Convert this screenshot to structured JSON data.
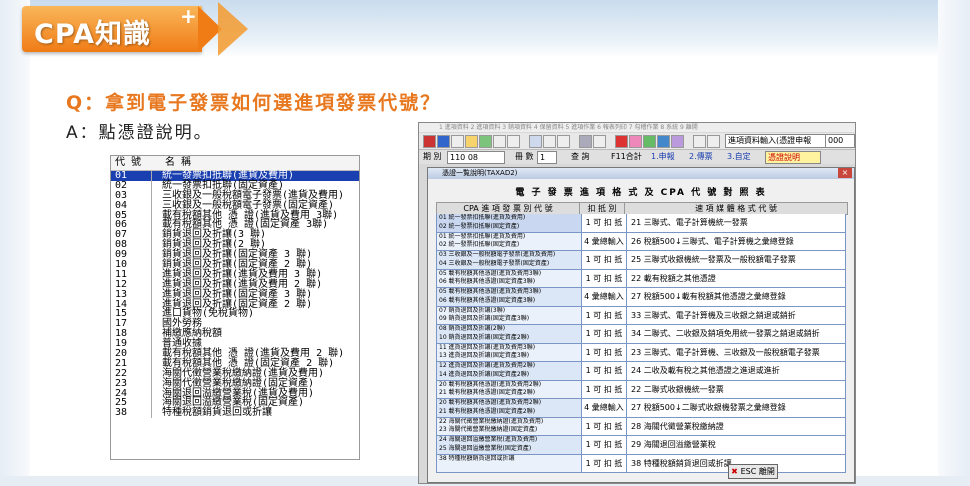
{
  "logo": {
    "text": "CPA知識",
    "plus": "+"
  },
  "question": "Q：拿到電子發票如何選進項發票代號？",
  "answer": "A：點憑證說明。",
  "code_table": {
    "header": {
      "code": "代 號",
      "name": "名 稱"
    },
    "rows": [
      {
        "code": "01",
        "name": "統一發票扣抵聯(進貨及費用)",
        "selected": true
      },
      {
        "code": "02",
        "name": "統一發票扣抵聯(固定資產)"
      },
      {
        "code": "03",
        "name": "三收銀及一般稅額電子發票(進貨及費用)"
      },
      {
        "code": "04",
        "name": "三收銀及一般稅額電子發票(固定資產)"
      },
      {
        "code": "05",
        "name": "載有稅額其他 憑 證(進貨及費用 3聯)"
      },
      {
        "code": "06",
        "name": "載有稅額其他 憑 證(固定資產 3聯)"
      },
      {
        "code": "07",
        "name": "銷貨退回及折讓(3 聯)"
      },
      {
        "code": "08",
        "name": "銷貨退回及折讓(2 聯)"
      },
      {
        "code": "09",
        "name": "銷貨退回及折讓(固定資產 3 聯)"
      },
      {
        "code": "10",
        "name": "銷貨退回及折讓(固定資產 2 聯)"
      },
      {
        "code": "11",
        "name": "進貨退回及折讓(進貨及費用 3 聯)"
      },
      {
        "code": "12",
        "name": "進貨退回及折讓(進貨及費用 2 聯)"
      },
      {
        "code": "13",
        "name": "進貨退回及折讓(固定資產 3 聯)"
      },
      {
        "code": "14",
        "name": "進貨退回及折讓(固定資產 2 聯)"
      },
      {
        "code": "15",
        "name": "進口貨物(免稅貨物)"
      },
      {
        "code": "17",
        "name": "國外勞務"
      },
      {
        "code": "18",
        "name": "補繳應納稅額"
      },
      {
        "code": "19",
        "name": "普通收據"
      },
      {
        "code": "20",
        "name": "載有稅額其他 憑 證(進貨及費用 2 聯)"
      },
      {
        "code": "21",
        "name": "載有稅額其他 憑 證(固定資產 2 聯)"
      },
      {
        "code": "22",
        "name": "海關代徵營業稅繳納證(進貨及費用)"
      },
      {
        "code": "23",
        "name": "海關代徵營業稅繳納證(固定資產)"
      },
      {
        "code": "24",
        "name": "海關退回溢繳營業稅(進貨及費用)"
      },
      {
        "code": "25",
        "name": "海關退回溢繳營業稅(固定資產)"
      },
      {
        "code": "38",
        "name": "特種稅額銷貨退回或折讓"
      }
    ]
  },
  "window": {
    "menubar": "1 進項資料   2 進項資料   3 銷項資料   4 保留資料   5 進項作業   6 報表列印   7 勾稽作業   8 系統   9 離開",
    "select_value": "進項資料輸入(憑證申報",
    "number_field": "000",
    "filter": {
      "period_label": "期 別",
      "period_value": "110 08",
      "count_label": "冊 數",
      "count_value": "1",
      "query_label": "查 詢",
      "f11_label": "F11合計",
      "radio1": "1.申報",
      "radio2": "2.傳票",
      "radio3": "3.自定",
      "help_label": "憑證說明"
    },
    "dialog": {
      "title": "憑證一覧說明(TAXAD2)",
      "close": "×",
      "heading": "電 子 發 票 進 項 格 式 及 CPA 代 號 對 照 表",
      "columns": [
        "CPA 進 項 發 票 別 代 號",
        "扣 抵 別",
        "速 項 媒 體 格 式 代 號"
      ],
      "rows": [
        {
          "codes": [
            "01 統一發票扣抵聯(進貨及費用)",
            "02 統一發票扣抵聯(固定資產)"
          ],
          "deduct": "1 可 扣 抵",
          "media": "21 三聯式、電子計算機統一發票"
        },
        {
          "codes": [
            "01 統一發票扣抵聯(進貨及費用)",
            "02 統一發票扣抵聯(固定資產)"
          ],
          "deduct": "4 彙總輸入",
          "media": "26 稅額500↓三聯式、電子計算機之彙總登錄"
        },
        {
          "codes": [
            "03 三收銀及一般稅額電子發票(進貨及費用)",
            "04 三收銀及一般稅額電子發票(固定資產)"
          ],
          "deduct": "1 可 扣 抵",
          "media": "25 三聯式收銀機統一發票及一般稅額電子發票"
        },
        {
          "codes": [
            "05 載有稅額其他憑證(進貨及費用3聯)",
            "06 載有稅額其他憑證(固定資產3聯)"
          ],
          "deduct": "1 可 扣 抵",
          "media": "22 載有稅額之其他憑證"
        },
        {
          "codes": [
            "05 載有稅額其他憑證(進貨及費用3聯)",
            "06 載有稅額其他憑證(固定資產3聯)"
          ],
          "deduct": "4 彙總輸入",
          "media": "27 稅額500↓載有稅額其他憑證之彙總登錄"
        },
        {
          "codes": [
            "07 銷貨退回及折讓(3聯)",
            "09 銷貨退回及折讓(固定資產3聯)"
          ],
          "deduct": "1 可 扣 抵",
          "media": "33 三聯式、電子計算機及三收銀之銷退或銷折"
        },
        {
          "codes": [
            "08 銷貨退回及折讓(2聯)",
            "10 銷貨退回及折讓(固定資產2聯)"
          ],
          "deduct": "1 可 扣 抵",
          "media": "34 二聯式、二收銀及銷項免用統一發票之銷退或銷折"
        },
        {
          "codes": [
            "11 進貨退回及折讓(進貨及費用3聯)",
            "13 進貨退回及折讓(固定資產3聯)"
          ],
          "deduct": "1 可 扣 抵",
          "media": "23 三聯式、電子計算機、三收銀及一般稅額電子發票"
        },
        {
          "codes": [
            "12 進貨退回及折讓(進貨及費用2聯)",
            "14 進貨退回及折讓(固定資產2聯)"
          ],
          "deduct": "1 可 扣 抵",
          "media": "24 二收及載有稅之其他憑證之進退或進折"
        },
        {
          "codes": [
            "20 載有稅額其他憑證(進貨及費用2聯)",
            "21 載有稅額其他憑證(固定資產2聯)"
          ],
          "deduct": "1 可 扣 抵",
          "media": "22 二聯式收銀機統一發票"
        },
        {
          "codes": [
            "20 載有稅額其他憑證(進貨及費用2聯)",
            "21 載有稅額其他憑證(固定資產2聯)"
          ],
          "deduct": "4 彙總輸入",
          "media": "27 稅額500↓二聯式收銀機發票之彙總登錄"
        },
        {
          "codes": [
            "22 海關代徵營業稅繳納證(進貨及費用)",
            "23 海關代徵營業稅繳納證(固定資產)"
          ],
          "deduct": "1 可 扣 抵",
          "media": "28 海關代徵營業稅繳納證"
        },
        {
          "codes": [
            "24 海關退回溢繳營業稅(進貨及費用)",
            "25 海關退回溢繳營業稅(固定資產)"
          ],
          "deduct": "1 可 扣 抵",
          "media": "29 海關退回溢繳營業稅"
        },
        {
          "codes": [
            "38 特種稅額銷貨退回或折讓"
          ],
          "deduct": "1 可 扣 抵",
          "media": "38 特種稅額銷貨退回或折讓"
        }
      ],
      "esc_label": "ESC 離開"
    }
  }
}
